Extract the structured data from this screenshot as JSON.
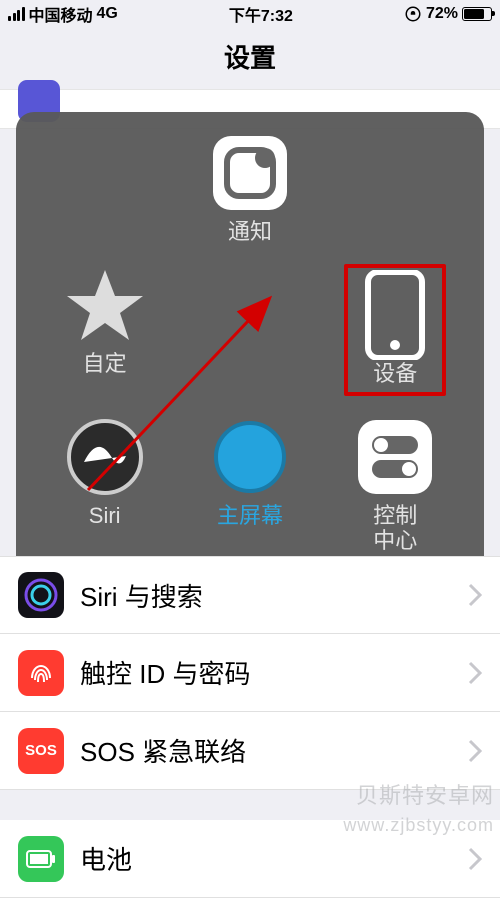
{
  "status": {
    "carrier": "中国移动",
    "network": "4G",
    "time": "下午7:32",
    "battery_pct": "72%"
  },
  "title": "设置",
  "overlay": {
    "notification": "通知",
    "custom": "自定",
    "device": "设备",
    "siri": "Siri",
    "home": "主屏幕",
    "control_center": "控制\n中心"
  },
  "list": {
    "siri_search": "Siri 与搜索",
    "touchid": "触控 ID 与密码",
    "sos": "SOS 紧急联络",
    "sos_icon": "SOS",
    "battery": "电池"
  },
  "watermark": {
    "text": "贝斯特安卓网",
    "url": "www.zjbstyy.com"
  },
  "colors": {
    "highlight": "#d30000",
    "arrow": "#d30000",
    "home_accent": "#2aa6e0"
  }
}
